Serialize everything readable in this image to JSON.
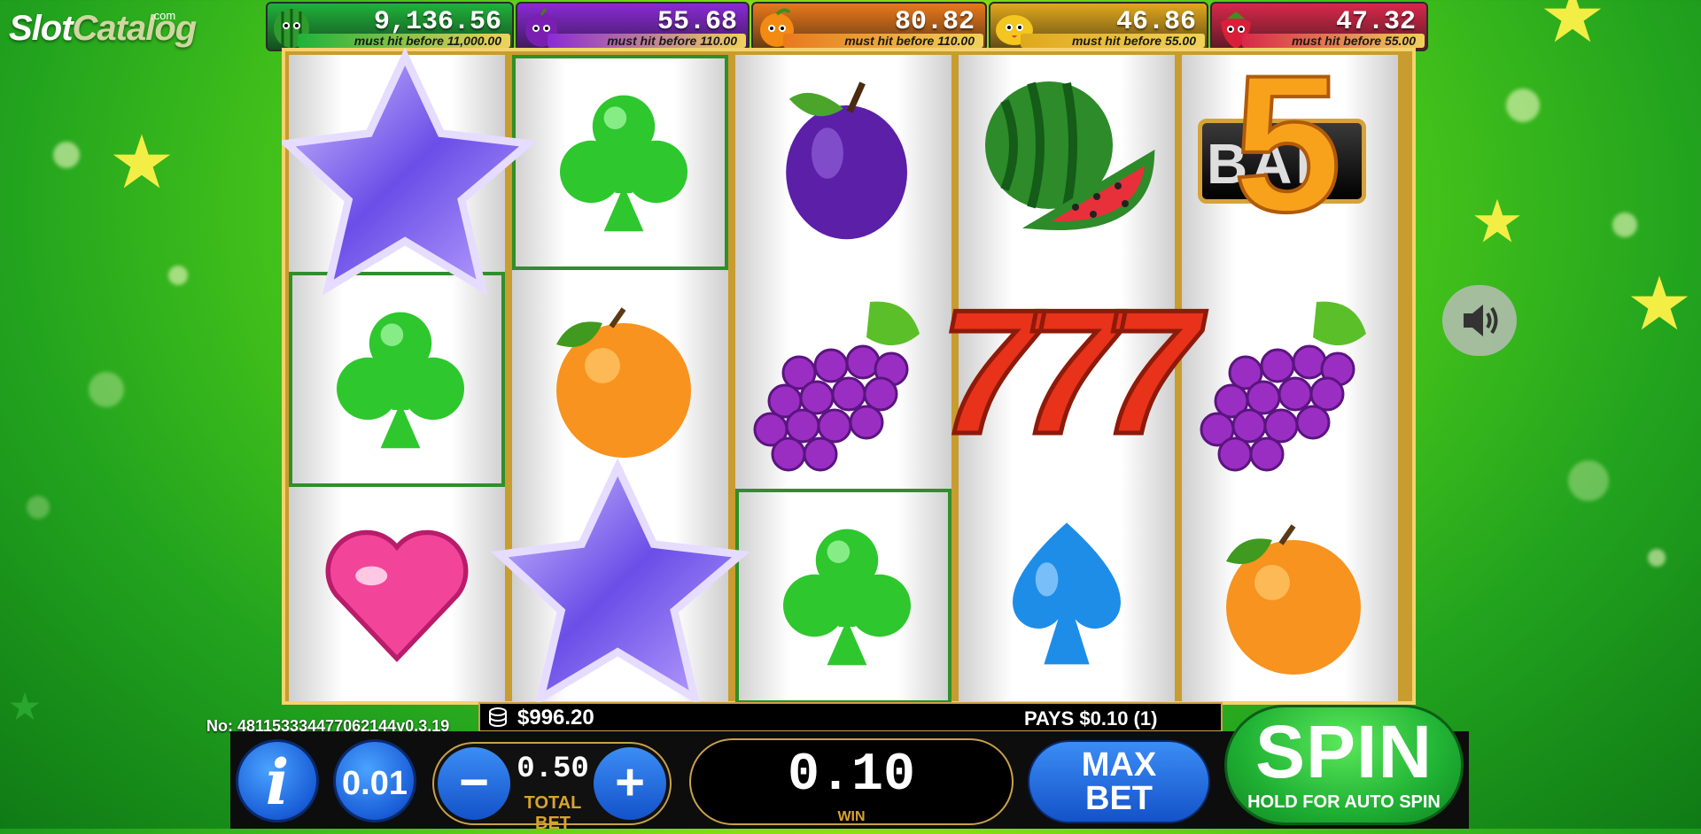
{
  "logo": {
    "part1": "Slot",
    "part2": "Catalog",
    "com": ".com"
  },
  "jackpots": [
    {
      "icon": "watermelon-icon",
      "value": "9,136.56",
      "must_hit": "must hit before 11,000.00",
      "color": "#1fb23a"
    },
    {
      "icon": "plum-icon",
      "value": "55.68",
      "must_hit": "must hit before 110.00",
      "color": "#8a2ad6"
    },
    {
      "icon": "orange-icon",
      "value": "80.82",
      "must_hit": "must hit before 110.00",
      "color": "#e8791c"
    },
    {
      "icon": "lemon-icon",
      "value": "46.86",
      "must_hit": "must hit before 55.00",
      "color": "#e0a81c"
    },
    {
      "icon": "strawberry-icon",
      "value": "47.32",
      "must_hit": "must hit before 55.00",
      "color": "#d8284a"
    }
  ],
  "reels": [
    [
      "star-wild-icon",
      "club-icon",
      "heart-icon"
    ],
    [
      "club-icon",
      "orange-icon",
      "star-wild-icon"
    ],
    [
      "plum-icon",
      "grapes-icon",
      "club-icon"
    ],
    [
      "watermelon-icon",
      "seven-icon",
      "spade-icon"
    ],
    [
      "bar-5-icon",
      "grapes-icon",
      "orange-icon"
    ]
  ],
  "bar_symbol": {
    "number": "5",
    "text": "BAR"
  },
  "seven_symbol": {
    "text": "777"
  },
  "game_number": "No: 4811533344770621​44v0.3.19",
  "balance": "$996.20",
  "pays": "PAYS $0.10  (1)",
  "coin_value": "0.01",
  "info_label": "i",
  "bet": {
    "value": "0.50",
    "label": "TOTAL BET",
    "minus": "−",
    "plus": "+"
  },
  "win": {
    "value": "0.10",
    "label": "WIN"
  },
  "max_bet": {
    "line1": "MAX",
    "line2": "BET"
  },
  "spin": {
    "label": "SPIN",
    "sub": "HOLD FOR AUTO SPIN"
  },
  "sound_icon": "speaker-icon"
}
